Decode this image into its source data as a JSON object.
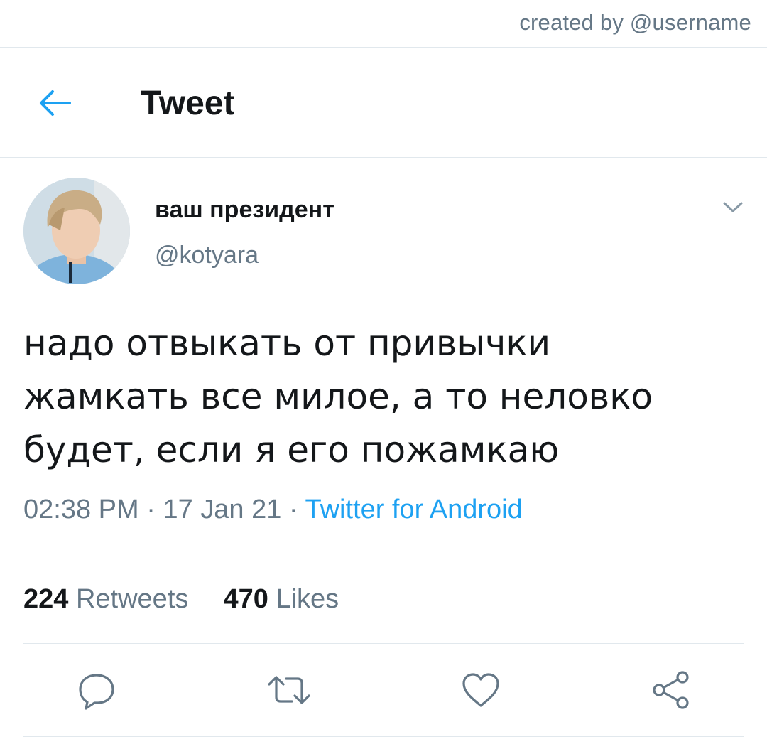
{
  "credit": "created by @username",
  "header": {
    "title": "Tweet"
  },
  "tweet": {
    "display_name": "ваш президент",
    "handle": "@kotyara",
    "text_lines": [
      "надо отвыкать от привычки",
      "жамкать все милое, а то неловко",
      "будет, если я его пожамкаю"
    ],
    "time": "02:38 PM",
    "date": "17 Jan 21",
    "separator": "·",
    "source": "Twitter for Android"
  },
  "stats": {
    "retweets_count": "224",
    "retweets_label": "Retweets",
    "likes_count": "470",
    "likes_label": "Likes"
  },
  "icons": {
    "back": "arrow-left-icon",
    "caret": "chevron-down-icon",
    "reply": "reply-icon",
    "retweet": "retweet-icon",
    "like": "heart-icon",
    "share": "share-icon"
  },
  "colors": {
    "accent": "#1da1f2",
    "secondary_text": "#657786",
    "primary_text": "#14171a",
    "divider": "#e1e8ed"
  }
}
